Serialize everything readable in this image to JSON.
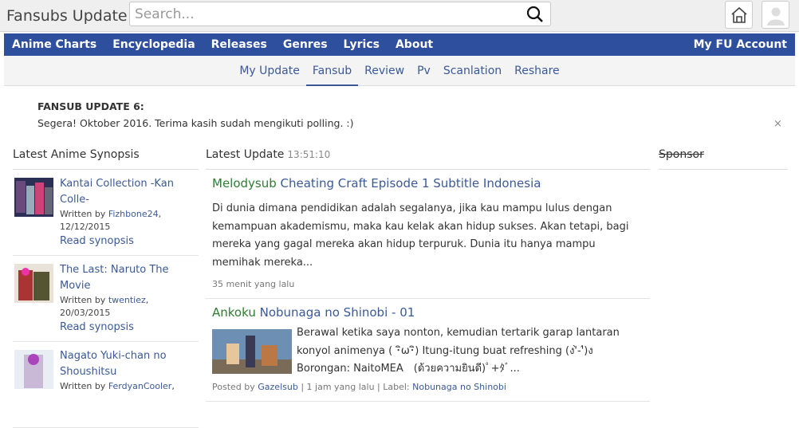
{
  "header": {
    "brand": "Fansubs Update",
    "search_placeholder": "Search..."
  },
  "nav_primary": [
    "Anime Charts",
    "Encyclopedia",
    "Releases",
    "Genres",
    "Lyrics",
    "About"
  ],
  "nav_account": "My FU Account",
  "nav_secondary": [
    "My Update",
    "Fansub",
    "Review",
    "Pv",
    "Scanlation",
    "Reshare"
  ],
  "notice": {
    "title": "FANSUB UPDATE 6:",
    "text": "Segera! Oktober 2016. Terima kasih sudah mengikuti polling. :)",
    "close": "×"
  },
  "left": {
    "title": "Latest Anime Synopsis",
    "items": [
      {
        "title": "Kantai Collection -Kan Colle-",
        "written": "Written by ",
        "author": "Fizhbone24",
        "date": ", 12/12/2015",
        "read": "Read synopsis"
      },
      {
        "title": "The Last: Naruto The Movie",
        "written": "Written by ",
        "author": "twentiez",
        "date": ", 20/03/2015",
        "read": "Read synopsis"
      },
      {
        "title": "Nagato Yuki-chan no Shoushitsu",
        "written": "Written by ",
        "author": "FerdyanCooler",
        "date": ",",
        "read": ""
      }
    ]
  },
  "center": {
    "title": "Latest Update",
    "time": "13:51:10",
    "posts": [
      {
        "source": "Melodysub",
        "title": " Cheating Craft Episode 1 Subtitle Indonesia",
        "body": "Di dunia dimana pendidikan adalah segalanya, jika kau mampu lulus dengan kemampuan akademismu, maka kau kelak akan hidup sukses. Akan tetapi, bagi mereka yang gagal mereka akan hidup terpuruk. Dunia itu hanya mampu memihak mereka...",
        "meta": "35 menit yang lalu"
      },
      {
        "source": "Ankoku",
        "title": " Nobunaga no Shinobi - 01",
        "body": "Berawal ketika saya nonton, kemudian tertarik garap lantaran konyol animenya ( ･ิω･ิ) Itung-itung buat refreshing (ง'̀-'́)ง Borongan: NaitoMEA　(ด้วยความยินดี)ﾟ+ﾀﾞ...",
        "posted": "Posted by ",
        "poster": "Gazelsub",
        "sep1": " | 1 jam yang lalu | Label: ",
        "label": "Nobunaga no Shinobi"
      }
    ]
  },
  "right": {
    "title": "Sponsor"
  }
}
